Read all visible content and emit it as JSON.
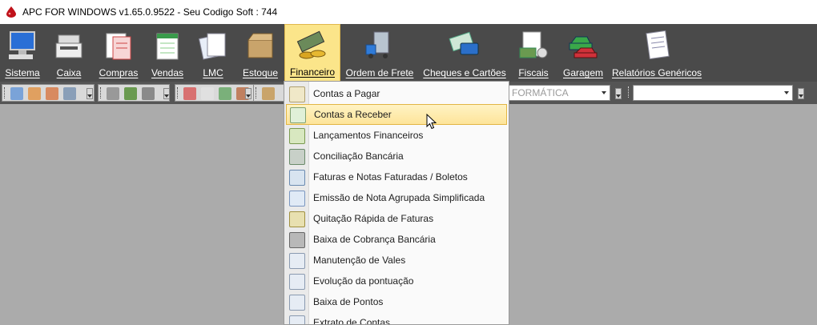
{
  "window": {
    "title": "APC FOR WINDOWS v1.65.0.9522 - Seu Codigo Soft : 744"
  },
  "ribbon": {
    "items": [
      {
        "label": "Sistema",
        "icon": "computer-icon"
      },
      {
        "label": "Caixa",
        "icon": "cash-register-icon"
      },
      {
        "label": "Compras",
        "icon": "purchase-form-icon"
      },
      {
        "label": "Vendas",
        "icon": "sales-spreadsheet-icon"
      },
      {
        "label": "LMC",
        "icon": "documents-icon"
      },
      {
        "label": "Estoque",
        "icon": "box-icon"
      },
      {
        "label": "Financeiro",
        "icon": "money-icon"
      },
      {
        "label": "Ordem de Frete",
        "icon": "truck-icon"
      },
      {
        "label": "Cheques e Cartões",
        "icon": "cheque-card-icon"
      },
      {
        "label": "Fiscais",
        "icon": "fiscal-docs-icon"
      },
      {
        "label": "Garagem",
        "icon": "cars-icon"
      },
      {
        "label": "Relatórios Genéricos",
        "icon": "report-icon"
      }
    ],
    "active": "Financeiro"
  },
  "toolbar": {
    "combo1": "FORMÁTICA",
    "combo2": ""
  },
  "menu": {
    "items": [
      {
        "label": "Contas a Pagar",
        "icon": "ledger-icon"
      },
      {
        "label": "Contas a Receber",
        "icon": "ledger-receive-icon",
        "highlighted": true
      },
      {
        "label": "Lançamentos Financeiros",
        "icon": "cash-bag-icon"
      },
      {
        "label": "Conciliação Bancária",
        "icon": "bank-reconcile-icon"
      },
      {
        "label": "Faturas e Notas Faturadas / Boletos",
        "icon": "invoice-icon"
      },
      {
        "label": "Emissão de Nota Agrupada Simplificada",
        "icon": "grouped-note-icon"
      },
      {
        "label": "Quitação Rápida de Faturas",
        "icon": "quick-payment-icon"
      },
      {
        "label": "Baixa de Cobrança Bancária",
        "icon": "safe-icon"
      },
      {
        "label": "Manutenção de Vales",
        "icon": "voucher-icon"
      },
      {
        "label": "Evolução da pontuação",
        "icon": "points-evolution-icon"
      },
      {
        "label": "Baixa de Pontos",
        "icon": "points-icon"
      },
      {
        "label": "Extrato de Contas",
        "icon": "statement-icon"
      }
    ]
  },
  "colors": {
    "ribbon_bg": "#4a4a4a",
    "workspace_bg": "#ababab",
    "highlight": "#fde49a"
  }
}
